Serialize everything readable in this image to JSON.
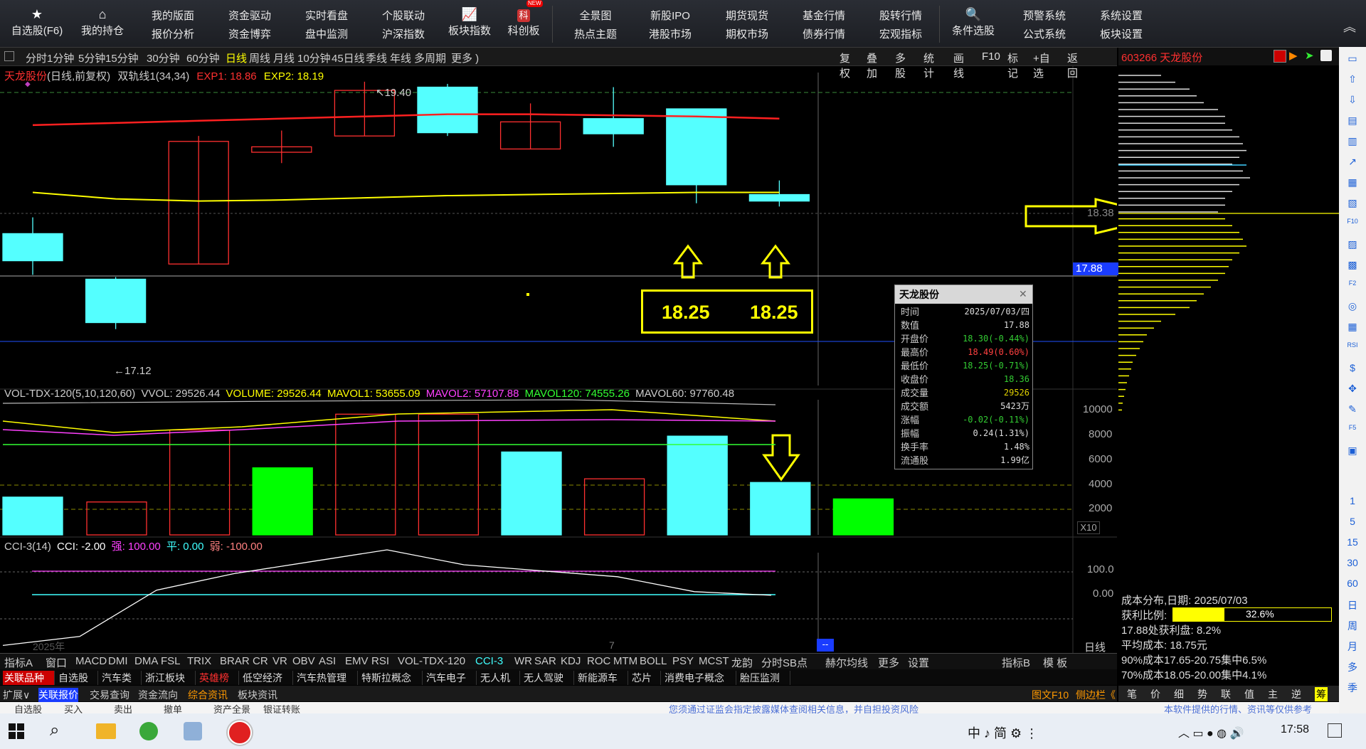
{
  "toolbar": {
    "icon_buttons": [
      {
        "label": "自选股(F6)",
        "icon": "star-icon"
      },
      {
        "label": "我的持仓",
        "icon": "home-icon"
      }
    ],
    "pairs": [
      [
        "我的版面",
        "报价分析"
      ],
      [
        "资金驱动",
        "资金博弈"
      ],
      [
        "实时看盘",
        "盘中监测"
      ],
      [
        "个股联动",
        "沪深指数"
      ]
    ],
    "board_index": {
      "label": "板块指数",
      "icon": "chart-line-icon"
    },
    "kechuang": {
      "label": "科创板",
      "icon": "kechuang-icon",
      "badge": "NEW",
      "glyph": "科"
    },
    "pairs2": [
      [
        "全景图",
        "热点主题"
      ],
      [
        "新股IPO",
        "港股市场"
      ],
      [
        "期货现货",
        "期权市场"
      ],
      [
        "基金行情",
        "债券行情"
      ],
      [
        "股转行情",
        "宏观指标"
      ]
    ],
    "condition_pick": {
      "label": "条件选股",
      "icon": "search-chart-icon"
    },
    "pairs3": [
      [
        "预警系统",
        "公式系统"
      ],
      [
        "系统设置",
        "板块设置"
      ]
    ]
  },
  "periods": [
    "分时",
    "1分钟",
    "5分钟",
    "15分钟",
    "30分钟",
    "60分钟",
    "日线",
    "周线",
    "月线",
    "10分钟",
    "45日线",
    "季线",
    "年线",
    "多周期",
    "更多 )"
  ],
  "active_period": "日线",
  "chart_tools": [
    "复权",
    "叠加",
    "多股",
    "统计",
    "画线",
    "F10",
    "标记",
    "+自选",
    "返回"
  ],
  "stock": {
    "code_name": "603266 天龙股份",
    "name": "天龙股份"
  },
  "main_header": {
    "name": "天龙股份",
    "mode": "(日线,前复权)",
    "indicator": "双轨线1(34,34)",
    "exp1_label": "EXP1: 18.86",
    "exp2_label": "EXP2: 18.19"
  },
  "price_annotations": {
    "high": "19.40",
    "low": "←17.12",
    "crosshair_price": "18.38",
    "axis_price": "17.88"
  },
  "callout": {
    "left_value": "18.25",
    "right_value": "18.25"
  },
  "vol_header": {
    "name": "VOL-TDX-120(5,10,120,60)",
    "vvol": "VVOL: 29526.44",
    "volume": "VOLUME: 29526.44",
    "mavol1": "MAVOL1: 53655.09",
    "mavol2": "MAVOL2: 57107.88",
    "mavol120": "MAVOL120: 74555.26",
    "mavol60": "MAVOL60: 97760.48"
  },
  "vol_axis": [
    "10000",
    "8000",
    "6000",
    "4000",
    "2000",
    "X10"
  ],
  "cci_header": {
    "name": "CCI-3(14)",
    "cci": "CCI: -2.00",
    "strong": "强: 100.00",
    "flat": "平: 0.00",
    "weak": "弱: -100.00"
  },
  "cci_axis": [
    "100.0",
    "0.00"
  ],
  "date_axis": {
    "year": "2025年",
    "mark": "7",
    "period_label": "日线",
    "cursor": "--"
  },
  "infobox": {
    "title": "天龙股份",
    "rows": [
      {
        "k": "时间",
        "v": "2025/07/03/四",
        "c": "#dddddd"
      },
      {
        "k": "数值",
        "v": "17.88",
        "c": "#dddddd"
      },
      {
        "k": "开盘价",
        "v": "18.30(-0.44%)",
        "c": "#33cc33"
      },
      {
        "k": "最高价",
        "v": "18.49(0.60%)",
        "c": "#ff4040"
      },
      {
        "k": "最低价",
        "v": "18.25(-0.71%)",
        "c": "#33cc33"
      },
      {
        "k": "收盘价",
        "v": "18.36",
        "c": "#33cc33"
      },
      {
        "k": "成交量",
        "v": "29526",
        "c": "#e0d000"
      },
      {
        "k": "成交额",
        "v": "5423万",
        "c": "#dddddd"
      },
      {
        "k": "涨幅",
        "v": "-0.02(-0.11%)",
        "c": "#33cc33"
      },
      {
        "k": "振幅",
        "v": "0.24(1.31%)",
        "c": "#dddddd"
      },
      {
        "k": "换手率",
        "v": "1.48%",
        "c": "#dddddd"
      },
      {
        "k": "流通股",
        "v": "1.99亿",
        "c": "#dddddd"
      }
    ]
  },
  "indicator_tabs": [
    "指标A",
    "窗口",
    "MACD",
    "DMI",
    "DMA",
    "FSL",
    "TRIX",
    "BRAR",
    "CR",
    "VR",
    "OBV",
    "ASI",
    "EMV",
    "RSI",
    "VOL-TDX-120",
    "CCI-3",
    "WR",
    "SAR",
    "KDJ",
    "ROC",
    "MTM",
    "BOLL",
    "PSY",
    "MCST",
    "龙韵",
    "分时SB点",
    "赫尔均线",
    "更多",
    "设置",
    "指标B",
    "模 板"
  ],
  "active_indicator": "CCI-3",
  "block_tabs": [
    "关联品种",
    "自选股",
    "汽车类",
    "浙江板块",
    "英雄榜",
    "低空经济",
    "汽车热管理",
    "特斯拉概念",
    "汽车电子",
    "无人机",
    "无人驾驶",
    "新能源车",
    "芯片",
    "消费电子概念",
    "胎压监测"
  ],
  "sub_tabs": [
    "扩展∨",
    "关联报价",
    "交易查询",
    "资金流向",
    "综合资讯",
    "板块资讯"
  ],
  "sub_right": [
    "图文F10",
    "侧边栏《"
  ],
  "side_tabs": [
    "笔",
    "价",
    "细",
    "势",
    "联",
    "值",
    "主",
    "逆",
    "筹"
  ],
  "cost": {
    "date_label": "成本分布,日期: 2025/07/03",
    "profit_label": "获利比例:",
    "profit_value": "32.6%",
    "profit_ratio": 0.326,
    "at_price": "17.88处获利盘: 8.2%",
    "avg": "平均成本: 18.75元",
    "c90": "90%成本17.65-20.75集中6.5%",
    "c70": "70%成本18.05-20.00集中4.1%"
  },
  "sidebar_numbers": [
    "1",
    "5",
    "15",
    "30",
    "60",
    "日",
    "周",
    "月",
    "多",
    "季"
  ],
  "taskbar": {
    "time": "17:58",
    "ime": "中 ♪ 简 ⚙ ⋮",
    "bottom_items": [
      "自选股",
      "买入",
      "卖出",
      "撤单",
      "资产全景",
      "银证转账"
    ],
    "notice": "您须通过证监会指定披露媒体查阅相关信息，并自担投资风险",
    "notice2": "本软件提供的行情、资讯等仅供参考"
  },
  "colors": {
    "up": "#ff3030",
    "down": "#54ffff",
    "vol_down": "#00ff00",
    "yellow": "#ffff00",
    "axis_blue": "#2050ff"
  },
  "chart_data": {
    "type": "candlestick",
    "candles": [
      {
        "o": 18.0,
        "h": 18.15,
        "l": 17.62,
        "c": 17.75
      },
      {
        "o": 17.58,
        "h": 17.6,
        "l": 17.12,
        "c": 17.18
      },
      {
        "o": 17.72,
        "h": 18.9,
        "l": 17.72,
        "c": 18.85
      },
      {
        "o": 18.75,
        "h": 18.95,
        "l": 18.65,
        "c": 18.8
      },
      {
        "o": 18.9,
        "h": 19.4,
        "l": 18.9,
        "c": 19.32
      },
      {
        "o": 19.35,
        "h": 19.38,
        "l": 18.9,
        "c": 18.93
      },
      {
        "o": 18.78,
        "h": 19.2,
        "l": 18.78,
        "c": 19.03
      },
      {
        "o": 19.06,
        "h": 19.35,
        "l": 18.8,
        "c": 18.92
      },
      {
        "o": 19.15,
        "h": 19.15,
        "l": 18.28,
        "c": 18.45
      },
      {
        "o": 18.36,
        "h": 18.49,
        "l": 18.25,
        "c": 18.3
      }
    ],
    "volumes": [
      {
        "v": 3100,
        "up": false
      },
      {
        "v": 2700,
        "up": true
      },
      {
        "v": 8600,
        "up": true
      },
      {
        "v": 5500,
        "up": false,
        "green": true
      },
      {
        "v": 9900,
        "up": true
      },
      {
        "v": 9900,
        "up": true
      },
      {
        "v": 6800,
        "up": false
      },
      {
        "v": 4600,
        "up": true
      },
      {
        "v": 8100,
        "up": false
      },
      {
        "v": 4300,
        "up": false
      },
      {
        "v": 2953,
        "up": false,
        "green": true
      }
    ],
    "ma_red": [
      19.0,
      19.02,
      19.04,
      19.06,
      19.08,
      19.1,
      19.1,
      19.09,
      19.08,
      19.06
    ],
    "ma_yellow": [
      18.38,
      18.32,
      18.3,
      18.31,
      18.33,
      18.35,
      18.36,
      18.37,
      18.38,
      18.38
    ],
    "cci": [
      -170,
      -140,
      15,
      70,
      110,
      150,
      100,
      80,
      60,
      10,
      -2
    ],
    "price_range": [
      16.6,
      19.55
    ],
    "vol_range": [
      0,
      10500
    ],
    "cci_range": [
      -190,
      190
    ]
  }
}
